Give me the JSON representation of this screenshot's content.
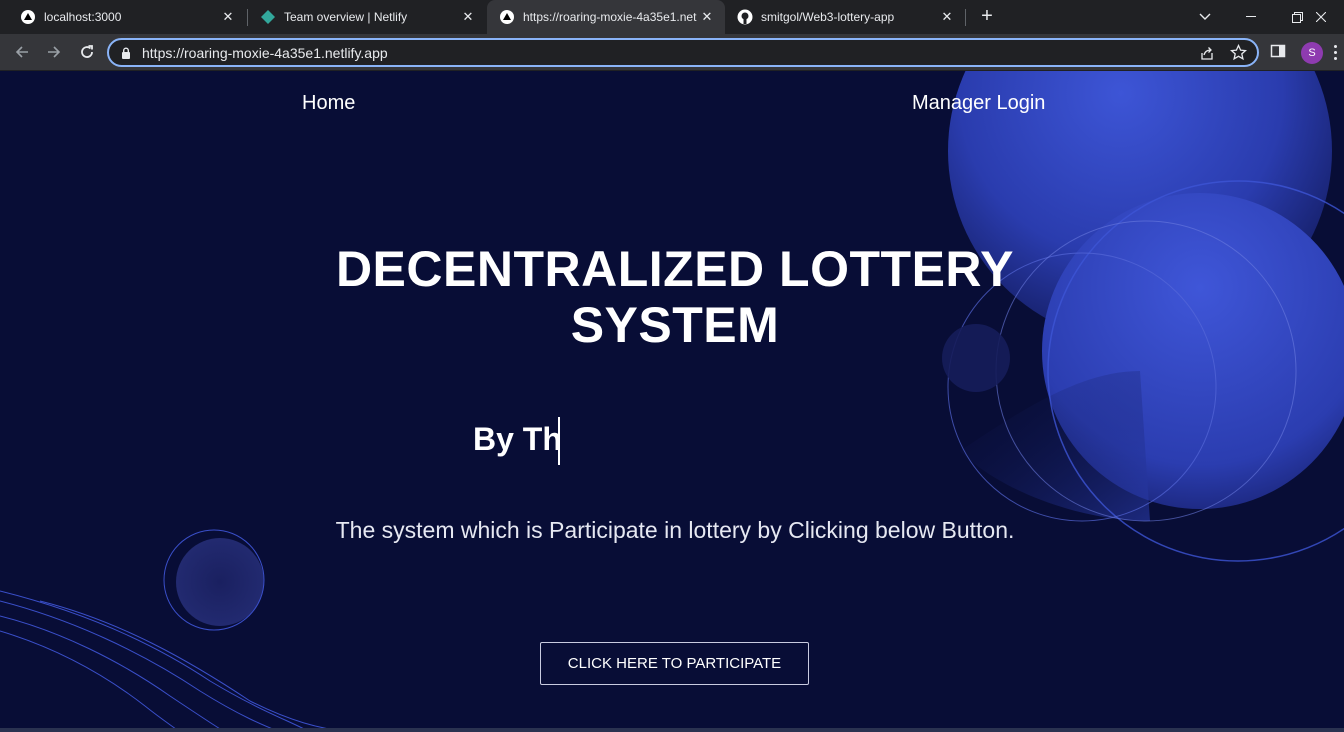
{
  "browser": {
    "tabs": [
      {
        "title": "localhost:3000",
        "icon": "nextjs-icon",
        "active": false
      },
      {
        "title": "Team overview | Netlify",
        "icon": "netlify-icon",
        "active": false
      },
      {
        "title": "https://roaring-moxie-4a35e1.net",
        "icon": "nextjs-icon",
        "active": true
      },
      {
        "title": "smitgol/Web3-lottery-app",
        "icon": "github-icon",
        "active": false
      }
    ],
    "url": "https://roaring-moxie-4a35e1.netlify.app",
    "profile_initial": "S"
  },
  "page": {
    "nav": {
      "home": "Home",
      "manager_login": "Manager Login"
    },
    "hero": {
      "title": "DECENTRALIZED LOTTERY SYSTEM",
      "typing_text": "By Th",
      "description": "The system which is Participate in lottery by Clicking below Button.",
      "cta": "CLICK HERE TO PARTICIPATE"
    }
  },
  "colors": {
    "page_background": "#080d36",
    "accent_blue": "#3a4fc9",
    "chrome_dark": "#202124",
    "chrome_toolbar": "#35363a",
    "focus_ring": "#8ab4f8"
  }
}
